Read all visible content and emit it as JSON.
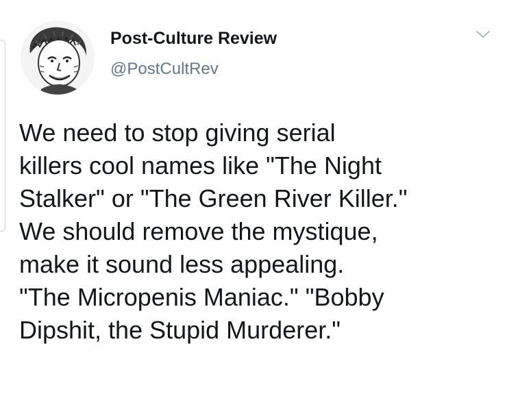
{
  "account": {
    "display_name": "Post-Culture Review",
    "handle": "@PostCultRev",
    "avatar_icon": "avatar-illustration"
  },
  "menu": {
    "icon": "chevron-down-icon"
  },
  "tweet": {
    "lines": [
      "We need to stop giving serial",
      "killers cool names like \"The Night",
      "Stalker\" or \"The Green River Killer.\"",
      "We should remove the mystique,",
      "make it sound less appealing.",
      "\"The Micropenis Maniac.\" \"Bobby",
      "Dipshit, the Stupid Murderer.\""
    ]
  },
  "colors": {
    "text": "#14171a",
    "secondary_text": "#657786",
    "background": "#ffffff",
    "caret": "#aab8c2"
  }
}
